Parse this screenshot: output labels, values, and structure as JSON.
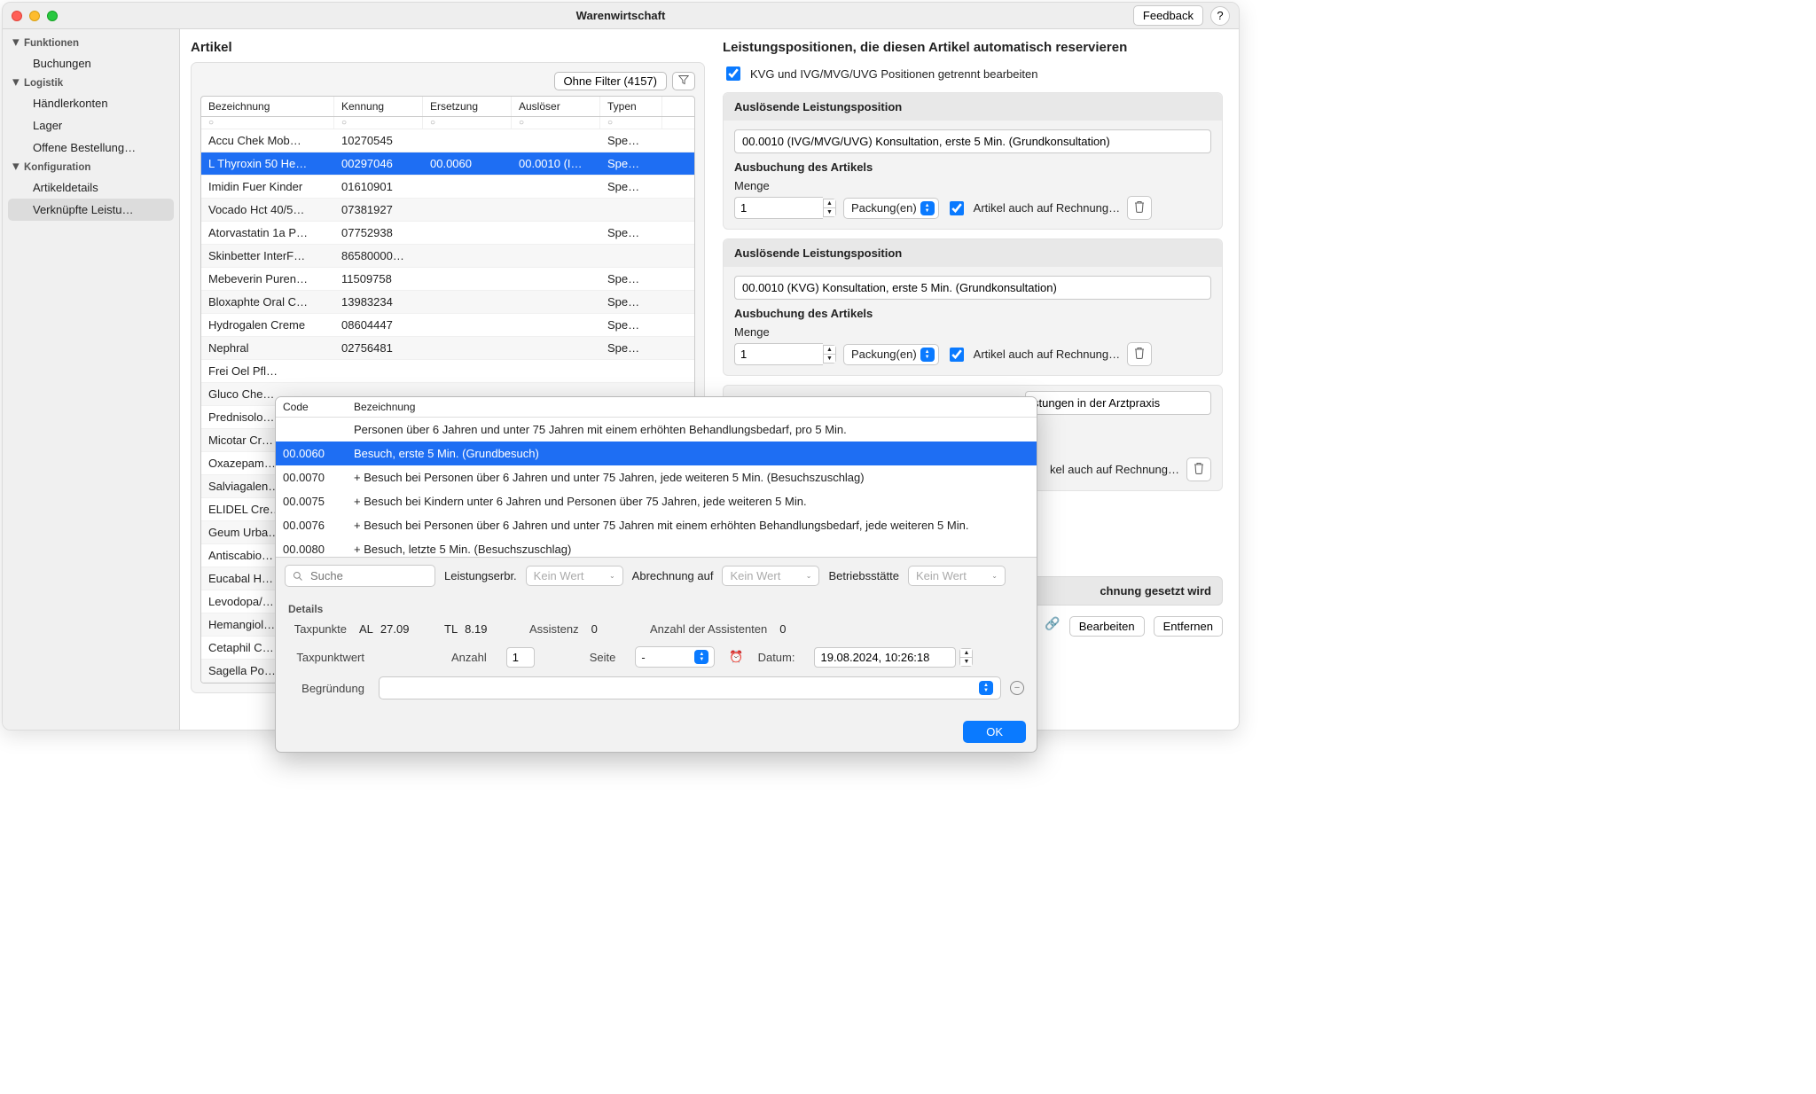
{
  "window": {
    "title": "Warenwirtschaft",
    "feedback": "Feedback",
    "help": "?"
  },
  "sidebar": {
    "groups": [
      {
        "title": "Funktionen",
        "items": [
          "Buchungen"
        ]
      },
      {
        "title": "Logistik",
        "items": [
          "Händlerkonten",
          "Lager",
          "Offene Bestellung…"
        ]
      },
      {
        "title": "Konfiguration",
        "items": [
          "Artikeldetails",
          "Verknüpfte Leistu…"
        ],
        "selected": 1
      }
    ]
  },
  "articles": {
    "title": "Artikel",
    "filter_button": "Ohne Filter (4157)",
    "columns": [
      "Bezeichnung",
      "Kennung",
      "Ersetzung",
      "Auslöser",
      "Typen"
    ],
    "rows": [
      {
        "c": [
          "Accu Chek Mob…",
          "10270545",
          "",
          "",
          "Spe…"
        ]
      },
      {
        "c": [
          "L Thyroxin 50 He…",
          "00297046",
          "00.0060",
          "00.0010 (I…",
          "Spe…"
        ],
        "sel": true
      },
      {
        "c": [
          "Imidin Fuer Kinder",
          "01610901",
          "",
          "",
          "Spe…"
        ]
      },
      {
        "c": [
          "Vocado Hct 40/5…",
          "07381927",
          "",
          "",
          ""
        ]
      },
      {
        "c": [
          "Atorvastatin 1a P…",
          "07752938",
          "",
          "",
          "Spe…"
        ]
      },
      {
        "c": [
          "Skinbetter InterF…",
          "86580000…",
          "",
          "",
          ""
        ]
      },
      {
        "c": [
          "Mebeverin Puren…",
          "11509758",
          "",
          "",
          "Spe…"
        ]
      },
      {
        "c": [
          "Bloxaphte Oral C…",
          "13983234",
          "",
          "",
          "Spe…"
        ]
      },
      {
        "c": [
          "Hydrogalen Creme",
          "08604447",
          "",
          "",
          "Spe…"
        ]
      },
      {
        "c": [
          "Nephral",
          "02756481",
          "",
          "",
          "Spe…"
        ]
      },
      {
        "c": [
          "Frei Oel Pfl…",
          "",
          "",
          "",
          ""
        ]
      },
      {
        "c": [
          "Gluco Che…",
          "",
          "",
          "",
          ""
        ]
      },
      {
        "c": [
          "Prednisolo…",
          "",
          "",
          "",
          ""
        ]
      },
      {
        "c": [
          "Micotar Cr…",
          "",
          "",
          "",
          ""
        ]
      },
      {
        "c": [
          "Oxazepam…",
          "",
          "",
          "",
          ""
        ]
      },
      {
        "c": [
          "Salviagalen…",
          "",
          "",
          "",
          ""
        ]
      },
      {
        "c": [
          "ELIDEL Cre…",
          "",
          "",
          "",
          ""
        ]
      },
      {
        "c": [
          "Geum Urba…",
          "",
          "",
          "",
          ""
        ]
      },
      {
        "c": [
          "Antiscabio…",
          "",
          "",
          "",
          ""
        ]
      },
      {
        "c": [
          "Eucabal H…",
          "",
          "",
          "",
          ""
        ]
      },
      {
        "c": [
          "Levodopa/…",
          "",
          "",
          "",
          ""
        ]
      },
      {
        "c": [
          "Hemangiol…",
          "",
          "",
          "",
          ""
        ]
      },
      {
        "c": [
          "Cetaphil C…",
          "",
          "",
          "",
          ""
        ]
      },
      {
        "c": [
          "Sagella Po…",
          "",
          "",
          "",
          ""
        ]
      }
    ]
  },
  "right": {
    "title": "Leistungspositionen, die diesen Artikel automatisch reservieren",
    "split_checkbox": "KVG und IVG/MVG/UVG Positionen getrennt bearbeiten",
    "blocks": [
      {
        "trigger_head": "Auslösende Leistungsposition",
        "trigger_value": "00.0010 (IVG/MVG/UVG) Konsultation, erste 5 Min. (Grundkonsultation)",
        "book_head": "Ausbuchung des Artikels",
        "qty_label": "Menge",
        "qty_value": "1",
        "unit": "Packung(en)",
        "on_invoice": "Artikel auch auf Rechnung…"
      },
      {
        "trigger_head": "Auslösende Leistungsposition",
        "trigger_value": "00.0010 (KVG) Konsultation, erste 5 Min. (Grundkonsultation)",
        "book_head": "Ausbuchung des Artikels",
        "qty_label": "Menge",
        "qty_value": "1",
        "unit": "Packung(en)",
        "on_invoice": "Artikel auch auf Rechnung…"
      }
    ],
    "partial_text_1": "stungen in der Arztpraxis",
    "partial_text_2": "kel auch auf Rechnung…",
    "collapse": "chnung gesetzt wird",
    "btn_edit": "Bearbeiten",
    "btn_remove": "Entfernen"
  },
  "popover": {
    "col_code": "Code",
    "col_desc": "Bezeichnung",
    "rows": [
      {
        "code": "",
        "desc": "Personen über 6 Jahren und unter 75 Jahren mit einem erhöhten Behandlungsbedarf, pro 5 Min."
      },
      {
        "code": "00.0060",
        "desc": "Besuch, erste 5 Min. (Grundbesuch)",
        "sel": true
      },
      {
        "code": "00.0070",
        "desc": "+ Besuch bei Personen über 6 Jahren und unter 75 Jahren, jede weiteren 5 Min. (Besuchszuschlag)"
      },
      {
        "code": "00.0075",
        "desc": "+ Besuch bei Kindern unter 6 Jahren und Personen über 75 Jahren, jede weiteren 5 Min."
      },
      {
        "code": "00.0076",
        "desc": "+ Besuch bei Personen über 6 Jahren und unter 75 Jahren mit einem erhöhten Behandlungsbedarf, jede weiteren 5 Min."
      },
      {
        "code": "00.0080",
        "desc": "+ Besuch, letzte 5 Min. (Besuchszuschlag)"
      }
    ],
    "search_placeholder": "Suche",
    "f1_label": "Leistungserbr.",
    "f1_value": "Kein Wert",
    "f2_label": "Abrechnung auf",
    "f2_value": "Kein Wert",
    "f3_label": "Betriebsstätte",
    "f3_value": "Kein Wert",
    "details_title": "Details",
    "taxpunkte": "Taxpunkte",
    "al_label": "AL",
    "al_val": "27.09",
    "tl_label": "TL",
    "tl_val": "8.19",
    "assist_label": "Assistenz",
    "assist_val": "0",
    "assist_n_label": "Anzahl der Assistenten",
    "assist_n_val": "0",
    "taxwert": "Taxpunktwert",
    "anzahl_label": "Anzahl",
    "anzahl_val": "1",
    "seite_label": "Seite",
    "seite_val": "-",
    "datum_label": "Datum:",
    "datum_val": "19.08.2024, 10:26:18",
    "reason_label": "Begründung",
    "ok": "OK"
  }
}
